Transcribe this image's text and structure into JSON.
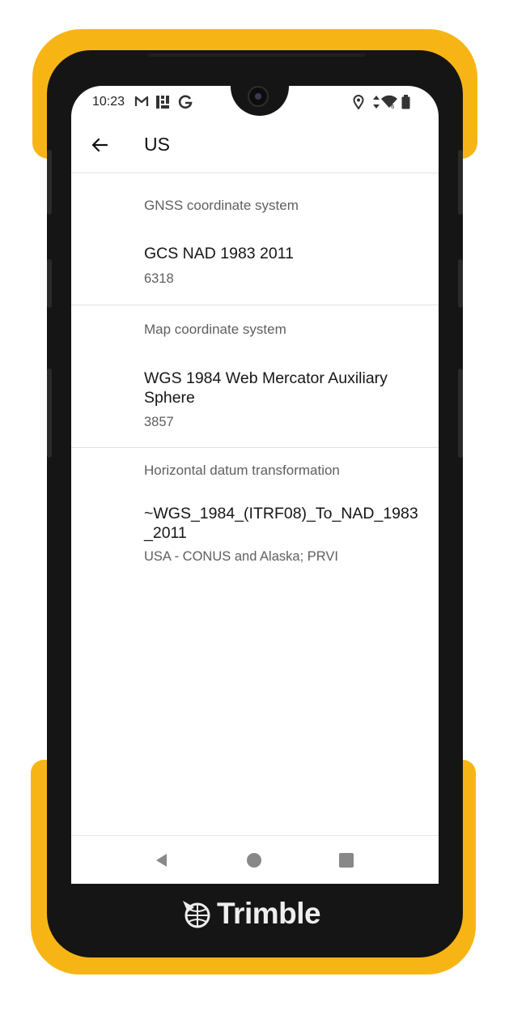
{
  "status_bar": {
    "time": "10:23",
    "icons": [
      "gmail-icon",
      "grid-app-icon",
      "google-icon",
      "location-icon",
      "data-arrows-icon",
      "wifi-icon",
      "battery-icon"
    ]
  },
  "app_bar": {
    "title": "US",
    "back_icon": "arrow-back-icon"
  },
  "sections": [
    {
      "header": "GNSS coordinate system",
      "name": "GCS NAD 1983 2011",
      "code": "6318"
    },
    {
      "header": "Map coordinate system",
      "name": "WGS 1984 Web Mercator Auxiliary Sphere",
      "code": "3857"
    },
    {
      "header": "Horizontal datum transformation",
      "name": "~WGS_1984_(ITRF08)_To_NAD_1983_2011",
      "code": "USA - CONUS and Alaska; PRVI"
    }
  ],
  "nav_bar": {
    "icons": [
      "back-triangle-icon",
      "home-circle-icon",
      "recents-square-icon"
    ]
  },
  "device": {
    "brand": "Trimble",
    "bumper_color": "#f7b515",
    "body_color": "#151515"
  }
}
